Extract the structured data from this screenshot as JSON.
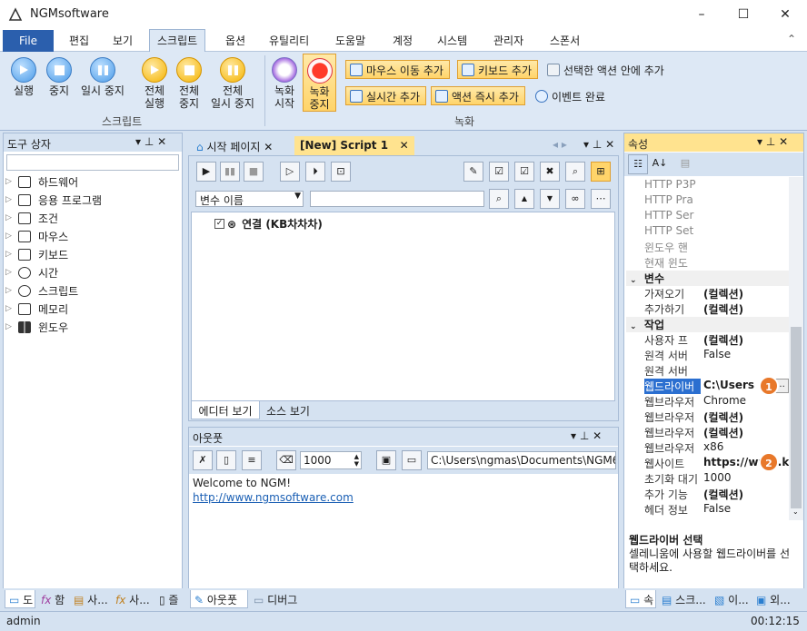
{
  "app": {
    "title": "NGMsoftware"
  },
  "window": {
    "min": "–",
    "max": "☐",
    "close": "✕"
  },
  "menu": {
    "file": "File",
    "tabs": [
      "편집",
      "보기",
      "스크립트",
      "옵션",
      "유틸리티",
      "도움말",
      "계정",
      "시스템",
      "관리자",
      "스폰서"
    ],
    "collapse": "⌃"
  },
  "ribbon": {
    "script_group": "스크립트",
    "run": "실행",
    "stop": "중지",
    "pause": "일시 중지",
    "run_all": [
      "전체",
      "실행"
    ],
    "stop_all": [
      "전체",
      "중지"
    ],
    "pause_all": [
      "전체",
      "일시 중지"
    ],
    "rec_start": [
      "녹화",
      "시작"
    ],
    "rec_stop": [
      "녹화",
      "중지"
    ],
    "rec_group": "녹화",
    "add_mouse": "마우스 이동 추가",
    "add_key": "키보드 추가",
    "add_in_action": "선택한 액션 안에 추가",
    "add_time": "실시간 추가",
    "add_action_now": "액션 즉시 추가",
    "event_done": "이벤트 완료"
  },
  "toolbox": {
    "title": "도구 상자",
    "items": [
      "하드웨어",
      "응용 프로그램",
      "조건",
      "마우스",
      "키보드",
      "시간",
      "스크립트",
      "메모리",
      "윈도우"
    ],
    "tabs": [
      "도",
      "함",
      "사...",
      "사...",
      "즐"
    ]
  },
  "doc": {
    "tabs": [
      "시작 페이지",
      "[New] Script 1"
    ],
    "var_select": "변수 이름",
    "node": "연결 (KB차차차)",
    "view_tabs": [
      "에디터 보기",
      "소스 보기"
    ]
  },
  "output": {
    "title": "아웃풋",
    "count": "1000",
    "path": "C:\\Users\\ngmas\\Documents\\NGM6\\",
    "lines": [
      "Welcome to NGM!",
      "http://www.ngmsoftware.com"
    ],
    "tabs": [
      "아웃풋",
      "디버그"
    ]
  },
  "props": {
    "title": "속성",
    "rows_top": [
      "HTTP P3P",
      "HTTP Pra",
      "HTTP Ser",
      "HTTP Set",
      "윈도우 핸",
      "현재 윈도"
    ],
    "cat1": "변수",
    "vars": [
      {
        "n": "가져오기",
        "v": "(컬렉션)"
      },
      {
        "n": "추가하기",
        "v": "(컬렉션)"
      }
    ],
    "cat2": "작업",
    "tasks": [
      {
        "n": "사용자 프",
        "v": "(컬렉션)",
        "b": true
      },
      {
        "n": "원격 서버",
        "v": "False",
        "b": false
      },
      {
        "n": "원격 서버",
        "v": "",
        "b": false
      },
      {
        "n": "웹드라이버",
        "v": "C:\\Users",
        "b": true
      },
      {
        "n": "웹브라우저",
        "v": "Chrome",
        "b": false
      },
      {
        "n": "웹브라우저",
        "v": "(컬렉션)",
        "b": true
      },
      {
        "n": "웹브라우저",
        "v": "(컬렉션)",
        "b": true
      },
      {
        "n": "웹브라우저",
        "v": "x86",
        "b": false
      },
      {
        "n": "웹사이트",
        "v": "https://www.k",
        "b": true
      },
      {
        "n": "초기화 대기",
        "v": "1000",
        "b": false
      },
      {
        "n": "추가 기능",
        "v": "(컬렉션)",
        "b": true
      },
      {
        "n": "헤더 정보",
        "v": "False",
        "b": false
      }
    ],
    "desc_title": "웹드라이버 선택",
    "desc_body": "셀레니움에 사용할 웹드라이버를 선택하세요.",
    "tabs": [
      "속",
      "스크...",
      "이...",
      "외..."
    ],
    "ellipsis": "..."
  },
  "badges": [
    "1",
    "2"
  ],
  "status": {
    "user": "admin",
    "time": "00:12:15"
  },
  "colors": {
    "accent": "#2b5fad",
    "active_head": "#ffe38f",
    "badge": "#e8782a"
  }
}
